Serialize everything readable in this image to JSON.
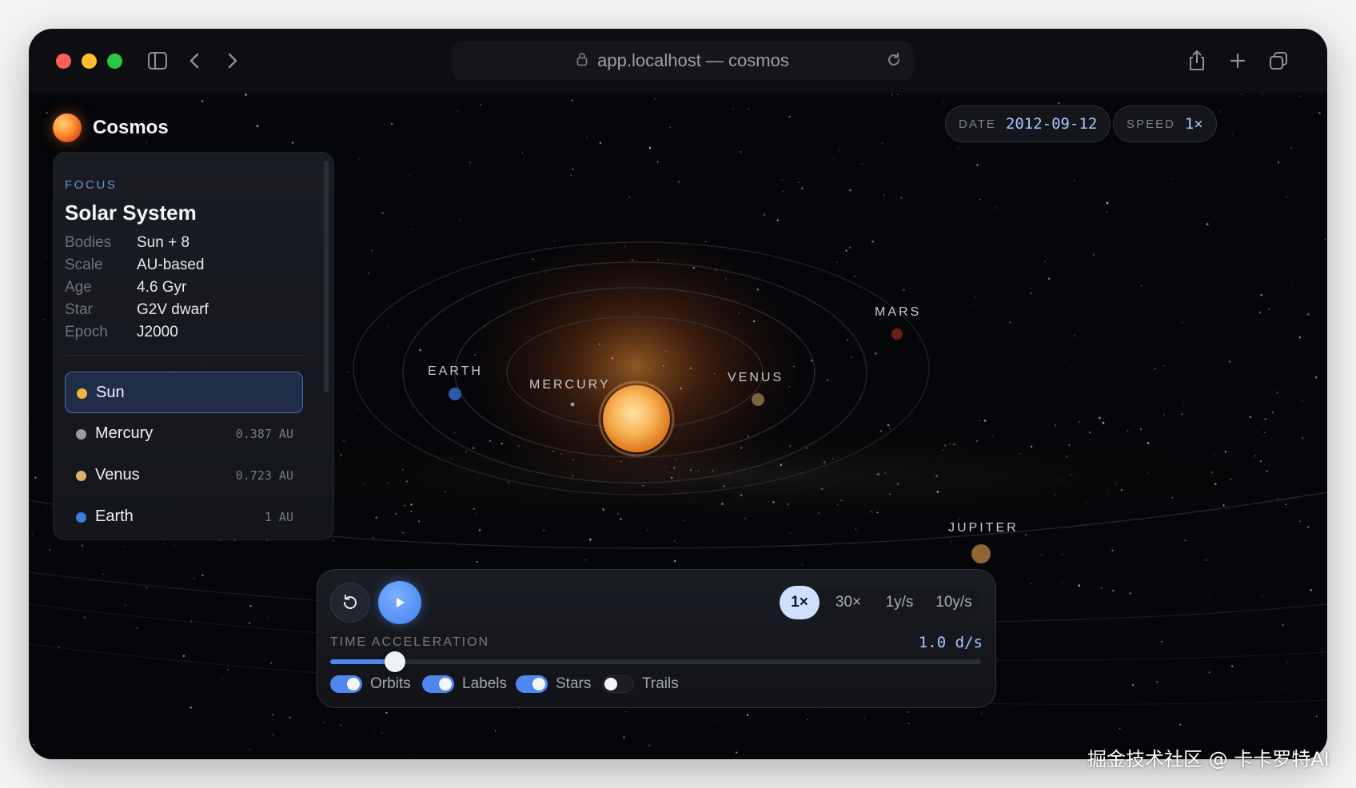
{
  "browser": {
    "url": "app.localhost — cosmos",
    "traffic_light_colors": [
      "#ff5f57",
      "#febc2e",
      "#28c840"
    ]
  },
  "app": {
    "name": "Cosmos"
  },
  "panel": {
    "focus_label": "FOCUS",
    "title": "Solar System",
    "stats": [
      {
        "key": "Bodies",
        "value": "Sun + 8"
      },
      {
        "key": "Scale",
        "value": "AU-based"
      },
      {
        "key": "Age",
        "value": "4.6 Gyr"
      },
      {
        "key": "Star",
        "value": "G2V dwarf"
      },
      {
        "key": "Epoch",
        "value": "J2000"
      }
    ],
    "bodies": [
      {
        "name": "Sun",
        "distance": "",
        "color": "#f5b53c",
        "selected": true
      },
      {
        "name": "Mercury",
        "distance": "0.387 AU",
        "color": "#9a9a9a",
        "selected": false
      },
      {
        "name": "Venus",
        "distance": "0.723 AU",
        "color": "#d9b36e",
        "selected": false
      },
      {
        "name": "Earth",
        "distance": "1 AU",
        "color": "#3d7be0",
        "selected": false
      }
    ]
  },
  "header": {
    "date_label": "DATE",
    "date_value": "2012-09-12",
    "speed_label": "SPEED",
    "speed_value": "1×"
  },
  "planet_labels": {
    "earth": "EARTH",
    "mercury": "MERCURY",
    "venus": "VENUS",
    "mars": "MARS",
    "jupiter": "JUPITER"
  },
  "controls": {
    "speed_options": [
      "1×",
      "30×",
      "1y/s",
      "10y/s"
    ],
    "active_speed": "1×",
    "time_accel_label": "TIME ACCELERATION",
    "time_accel_value": "1.0 d/s",
    "slider_fraction": 0.1,
    "toggles": [
      {
        "label": "Orbits",
        "on": true
      },
      {
        "label": "Labels",
        "on": true
      },
      {
        "label": "Stars",
        "on": true
      },
      {
        "label": "Trails",
        "on": false
      }
    ]
  },
  "colors": {
    "accent": "#4f86ef",
    "highlight": "#a9c6ff"
  },
  "watermark": "掘金技术社区 @ 卡卡罗特AI"
}
